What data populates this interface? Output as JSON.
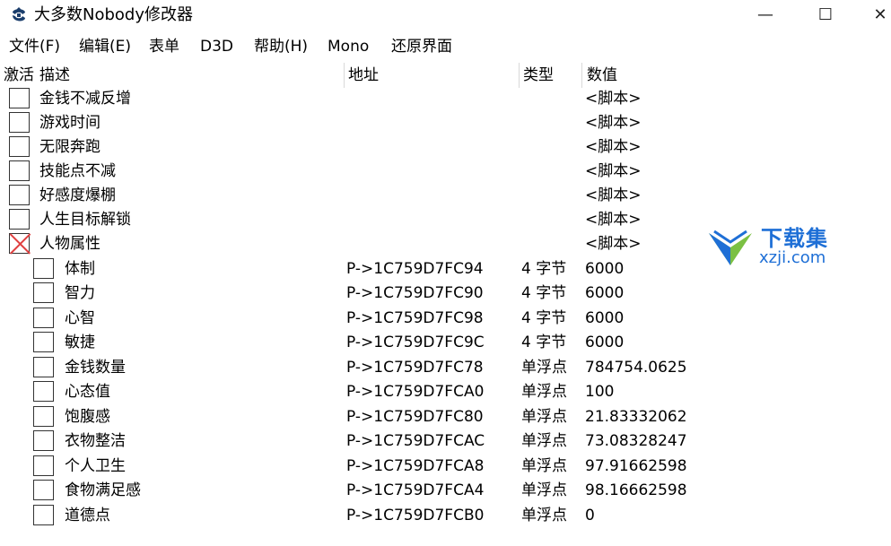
{
  "window": {
    "title": "大多数Nobody修改器",
    "min_glyph": "—",
    "max_glyph": "☐",
    "close_glyph": "✕"
  },
  "menu": [
    "文件(F)",
    "编辑(E)",
    "表单",
    "D3D",
    "帮助(H)",
    "Mono",
    "还原界面"
  ],
  "columns": {
    "active": "激活",
    "description": "描述",
    "address": "地址",
    "type": "类型",
    "value": "数值"
  },
  "rows": [
    {
      "desc": "金钱不减反增",
      "address": "",
      "type": "",
      "value": "<脚本>",
      "active": false,
      "child": false
    },
    {
      "desc": "游戏时间",
      "address": "",
      "type": "",
      "value": "<脚本>",
      "active": false,
      "child": false
    },
    {
      "desc": "无限奔跑",
      "address": "",
      "type": "",
      "value": "<脚本>",
      "active": false,
      "child": false
    },
    {
      "desc": "技能点不减",
      "address": "",
      "type": "",
      "value": "<脚本>",
      "active": false,
      "child": false
    },
    {
      "desc": "好感度爆棚",
      "address": "",
      "type": "",
      "value": "<脚本>",
      "active": false,
      "child": false
    },
    {
      "desc": "人生目标解锁",
      "address": "",
      "type": "",
      "value": "<脚本>",
      "active": false,
      "child": false
    },
    {
      "desc": "人物属性",
      "address": "",
      "type": "",
      "value": "<脚本>",
      "active": true,
      "child": false
    },
    {
      "desc": "体制",
      "address": "P->1C759D7FC94",
      "type": "4 字节",
      "value": "6000",
      "active": false,
      "child": true
    },
    {
      "desc": "智力",
      "address": "P->1C759D7FC90",
      "type": "4 字节",
      "value": "6000",
      "active": false,
      "child": true
    },
    {
      "desc": "心智",
      "address": "P->1C759D7FC98",
      "type": "4 字节",
      "value": "6000",
      "active": false,
      "child": true
    },
    {
      "desc": "敏捷",
      "address": "P->1C759D7FC9C",
      "type": "4 字节",
      "value": "6000",
      "active": false,
      "child": true
    },
    {
      "desc": "金钱数量",
      "address": "P->1C759D7FC78",
      "type": "单浮点",
      "value": "784754.0625",
      "active": false,
      "child": true
    },
    {
      "desc": "心态值",
      "address": "P->1C759D7FCA0",
      "type": "单浮点",
      "value": "100",
      "active": false,
      "child": true
    },
    {
      "desc": "饱腹感",
      "address": "P->1C759D7FC80",
      "type": "单浮点",
      "value": "21.83332062",
      "active": false,
      "child": true
    },
    {
      "desc": "衣物整洁",
      "address": "P->1C759D7FCAC",
      "type": "单浮点",
      "value": "73.08328247",
      "active": false,
      "child": true
    },
    {
      "desc": "个人卫生",
      "address": "P->1C759D7FCA8",
      "type": "单浮点",
      "value": "97.91662598",
      "active": false,
      "child": true
    },
    {
      "desc": "食物满足感",
      "address": "P->1C759D7FCA4",
      "type": "单浮点",
      "value": "98.16662598",
      "active": false,
      "child": true
    },
    {
      "desc": "道德点",
      "address": "P->1C759D7FCB0",
      "type": "单浮点",
      "value": "0",
      "active": false,
      "child": true
    }
  ],
  "watermark": {
    "text_cn": "下载集",
    "text_url": "xzji.com",
    "color": "#1e6fd6",
    "accent": "#7bc043"
  }
}
